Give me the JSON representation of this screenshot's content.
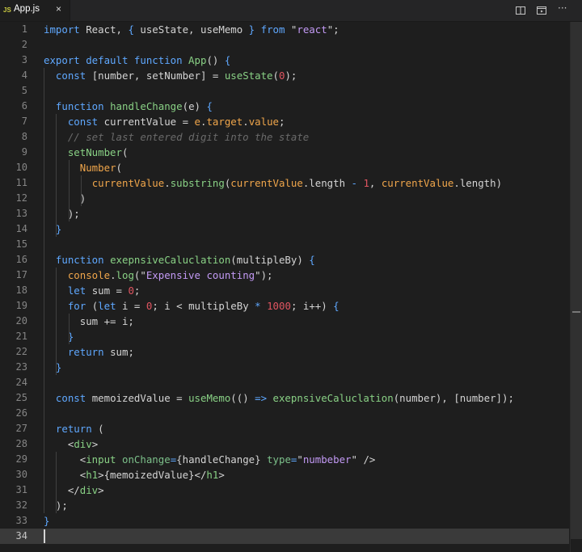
{
  "tab": {
    "icon": "JS",
    "name": "App.js",
    "close": "×"
  },
  "actions": [
    "split-editor-icon",
    "open-preview-icon",
    "more-actions-icon"
  ],
  "more_label": "···",
  "active_line": 34,
  "lines": [
    [
      [
        "t-kw",
        "import"
      ],
      [
        "t-var",
        " React, "
      ],
      [
        "t-kw",
        "{"
      ],
      [
        "t-var",
        " useState, useMemo "
      ],
      [
        "t-kw",
        "}"
      ],
      [
        "t-var",
        " "
      ],
      [
        "t-kw",
        "from"
      ],
      [
        "t-var",
        " "
      ],
      [
        "t-var",
        "\""
      ],
      [
        "t-str",
        "react"
      ],
      [
        "t-var",
        "\";"
      ]
    ],
    [],
    [
      [
        "t-kw",
        "export default function"
      ],
      [
        "t-var",
        " "
      ],
      [
        "t-fn",
        "App"
      ],
      [
        "t-var",
        "() "
      ],
      [
        "t-kw",
        "{"
      ]
    ],
    [
      [
        "t-var",
        "  "
      ],
      [
        "t-kw",
        "const"
      ],
      [
        "t-var",
        " [number, setNumber] = "
      ],
      [
        "t-fn",
        "useState"
      ],
      [
        "t-var",
        "("
      ],
      [
        "t-num",
        "0"
      ],
      [
        "t-var",
        ");"
      ]
    ],
    [],
    [
      [
        "t-var",
        "  "
      ],
      [
        "t-kw",
        "function"
      ],
      [
        "t-var",
        " "
      ],
      [
        "t-fn",
        "handleChange"
      ],
      [
        "t-var",
        "(e) "
      ],
      [
        "t-kw",
        "{"
      ]
    ],
    [
      [
        "t-var",
        "    "
      ],
      [
        "t-kw",
        "const"
      ],
      [
        "t-var",
        " currentValue = "
      ],
      [
        "t-prop",
        "e"
      ],
      [
        "t-var",
        "."
      ],
      [
        "t-prop",
        "target"
      ],
      [
        "t-var",
        "."
      ],
      [
        "t-prop",
        "value"
      ],
      [
        "t-var",
        ";"
      ]
    ],
    [
      [
        "t-var",
        "    "
      ],
      [
        "t-cmt",
        "// set last entered digit into the state"
      ]
    ],
    [
      [
        "t-var",
        "    "
      ],
      [
        "t-fn",
        "setNumber"
      ],
      [
        "t-var",
        "("
      ]
    ],
    [
      [
        "t-var",
        "      "
      ],
      [
        "t-prop",
        "Number"
      ],
      [
        "t-var",
        "("
      ]
    ],
    [
      [
        "t-var",
        "        "
      ],
      [
        "t-prop",
        "currentValue"
      ],
      [
        "t-var",
        "."
      ],
      [
        "t-fn",
        "substring"
      ],
      [
        "t-var",
        "("
      ],
      [
        "t-prop",
        "currentValue"
      ],
      [
        "t-var",
        ".length "
      ],
      [
        "t-op",
        "-"
      ],
      [
        "t-var",
        " "
      ],
      [
        "t-num",
        "1"
      ],
      [
        "t-var",
        ", "
      ],
      [
        "t-prop",
        "currentValue"
      ],
      [
        "t-var",
        ".length)"
      ]
    ],
    [
      [
        "t-var",
        "      )"
      ]
    ],
    [
      [
        "t-var",
        "    );"
      ]
    ],
    [
      [
        "t-var",
        "  "
      ],
      [
        "t-kw",
        "}"
      ]
    ],
    [],
    [
      [
        "t-var",
        "  "
      ],
      [
        "t-kw",
        "function"
      ],
      [
        "t-var",
        " "
      ],
      [
        "t-fn",
        "exepnsiveCaluclation"
      ],
      [
        "t-var",
        "(multipleBy) "
      ],
      [
        "t-kw",
        "{"
      ]
    ],
    [
      [
        "t-var",
        "    "
      ],
      [
        "t-prop",
        "console"
      ],
      [
        "t-var",
        "."
      ],
      [
        "t-fn",
        "log"
      ],
      [
        "t-var",
        "(\""
      ],
      [
        "t-str",
        "Expensive counting"
      ],
      [
        "t-var",
        "\");"
      ]
    ],
    [
      [
        "t-var",
        "    "
      ],
      [
        "t-kw",
        "let"
      ],
      [
        "t-var",
        " sum = "
      ],
      [
        "t-num",
        "0"
      ],
      [
        "t-var",
        ";"
      ]
    ],
    [
      [
        "t-var",
        "    "
      ],
      [
        "t-kw",
        "for"
      ],
      [
        "t-var",
        " ("
      ],
      [
        "t-kw",
        "let"
      ],
      [
        "t-var",
        " i = "
      ],
      [
        "t-num",
        "0"
      ],
      [
        "t-var",
        "; i < multipleBy "
      ],
      [
        "t-op",
        "*"
      ],
      [
        "t-var",
        " "
      ],
      [
        "t-num",
        "1000"
      ],
      [
        "t-var",
        "; i++) "
      ],
      [
        "t-kw",
        "{"
      ]
    ],
    [
      [
        "t-var",
        "      sum += i;"
      ]
    ],
    [
      [
        "t-var",
        "    "
      ],
      [
        "t-kw",
        "}"
      ]
    ],
    [
      [
        "t-var",
        "    "
      ],
      [
        "t-kw",
        "return"
      ],
      [
        "t-var",
        " sum;"
      ]
    ],
    [
      [
        "t-var",
        "  "
      ],
      [
        "t-kw",
        "}"
      ]
    ],
    [],
    [
      [
        "t-var",
        "  "
      ],
      [
        "t-kw",
        "const"
      ],
      [
        "t-var",
        " memoizedValue = "
      ],
      [
        "t-fn",
        "useMemo"
      ],
      [
        "t-var",
        "(() "
      ],
      [
        "t-op",
        "=>"
      ],
      [
        "t-var",
        " "
      ],
      [
        "t-fn",
        "exepnsiveCaluclation"
      ],
      [
        "t-var",
        "(number), [number]);"
      ]
    ],
    [],
    [
      [
        "t-var",
        "  "
      ],
      [
        "t-kw",
        "return"
      ],
      [
        "t-var",
        " ("
      ]
    ],
    [
      [
        "t-var",
        "    <"
      ],
      [
        "t-fn",
        "div"
      ],
      [
        "t-var",
        ">"
      ]
    ],
    [
      [
        "t-var",
        "      <"
      ],
      [
        "t-fn",
        "input"
      ],
      [
        "t-var",
        " "
      ],
      [
        "t-attr",
        "onChange"
      ],
      [
        "t-op",
        "="
      ],
      [
        "t-var",
        "{handleChange} "
      ],
      [
        "t-attr",
        "type"
      ],
      [
        "t-op",
        "="
      ],
      [
        "t-var",
        "\""
      ],
      [
        "t-str",
        "numbeber"
      ],
      [
        "t-var",
        "\" />"
      ]
    ],
    [
      [
        "t-var",
        "      <"
      ],
      [
        "t-fn",
        "h1"
      ],
      [
        "t-var",
        ">{memoizedValue}</"
      ],
      [
        "t-fn",
        "h1"
      ],
      [
        "t-var",
        ">"
      ]
    ],
    [
      [
        "t-var",
        "    </"
      ],
      [
        "t-fn",
        "div"
      ],
      [
        "t-var",
        ">"
      ]
    ],
    [
      [
        "t-var",
        "  );"
      ]
    ],
    [
      [
        "t-kw",
        "}"
      ]
    ],
    []
  ]
}
